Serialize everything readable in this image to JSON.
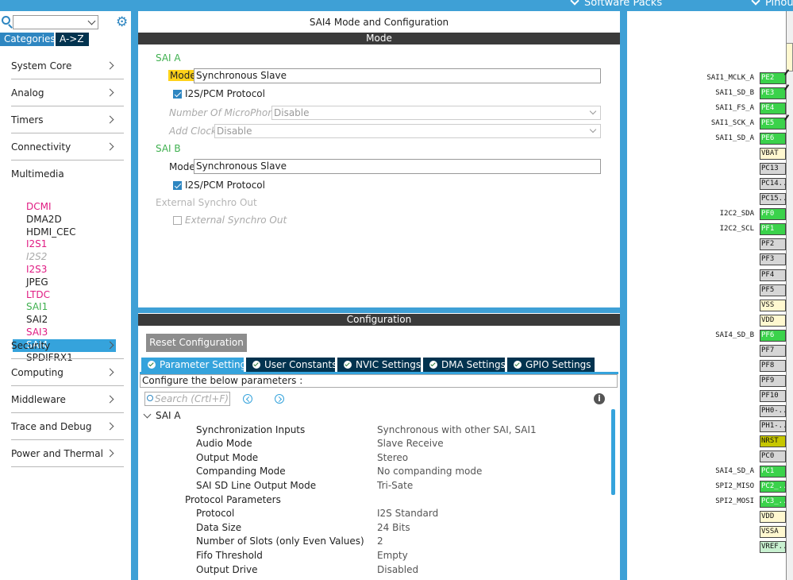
{
  "topbar": {
    "items": [
      {
        "label": "Software Packs"
      },
      {
        "label": "Pinout"
      }
    ]
  },
  "sidebar": {
    "search_value": "",
    "tabs": {
      "categories": "Categories",
      "az": "A->Z"
    },
    "categories": [
      {
        "label": "System Core"
      },
      {
        "label": "Analog"
      },
      {
        "label": "Timers"
      },
      {
        "label": "Connectivity"
      },
      {
        "label": "Multimedia"
      },
      {
        "label": "Security"
      },
      {
        "label": "Computing"
      },
      {
        "label": "Middleware"
      },
      {
        "label": "Trace and Debug"
      },
      {
        "label": "Power and Thermal"
      }
    ],
    "multimedia_items": [
      {
        "label": "DCMI",
        "status": "magenta"
      },
      {
        "label": "DMA2D",
        "status": "dark"
      },
      {
        "label": "HDMI_CEC",
        "status": "dark"
      },
      {
        "label": "I2S1",
        "status": "magenta"
      },
      {
        "label": "I2S2",
        "status": "grey"
      },
      {
        "label": "I2S3",
        "status": "magenta"
      },
      {
        "label": "JPEG",
        "status": "dark"
      },
      {
        "label": "LTDC",
        "status": "magenta"
      },
      {
        "label": "SAI1",
        "status": "green"
      },
      {
        "label": "SAI2",
        "status": "dark"
      },
      {
        "label": "SAI3",
        "status": "magenta"
      },
      {
        "label": "SAI4",
        "status": "selected"
      },
      {
        "label": "SPDIFRX1",
        "status": "dark"
      }
    ]
  },
  "mode_panel": {
    "title": "SAI4 Mode and Configuration",
    "bar": "Mode",
    "sai_a": {
      "title": "SAI A",
      "mode_label": "Mode",
      "mode_value": "Synchronous Slave",
      "protocol_label": "I2S/PCM Protocol",
      "microphones_label": "Number Of MicroPhones",
      "microphones_value": "Disable",
      "add_clock_label": "Add Clock",
      "add_clock_value": "Disable"
    },
    "sai_b": {
      "title": "SAI B",
      "mode_label": "Mode",
      "mode_value": "Synchronous Slave",
      "protocol_label": "I2S/PCM Protocol"
    },
    "ext_sync": {
      "title": "External Synchro Out",
      "checkbox_label": "External Synchro Out"
    }
  },
  "config_panel": {
    "bar": "Configuration",
    "reset_button": "Reset Configuration",
    "tabs": [
      {
        "label": "Parameter Settings",
        "active": true
      },
      {
        "label": "User Constants",
        "active": false
      },
      {
        "label": "NVIC Settings",
        "active": false
      },
      {
        "label": "DMA Settings",
        "active": false
      },
      {
        "label": "GPIO Settings",
        "active": false
      }
    ],
    "description": "Configure the below parameters :",
    "search_placeholder": "Search (Crtl+F)",
    "tree_group": "SAI A",
    "params": [
      {
        "name": "Synchronization Inputs",
        "value": "Synchronous with other SAI, SAI1",
        "level": 2
      },
      {
        "name": "Audio Mode",
        "value": "Slave Receive",
        "level": 2
      },
      {
        "name": "Output Mode",
        "value": "Stereo",
        "level": 2
      },
      {
        "name": "Companding Mode",
        "value": "No companding mode",
        "level": 2
      },
      {
        "name": "SAI SD Line Output Mode",
        "value": "Tri-Sate",
        "level": 2
      },
      {
        "name": "Protocol Parameters",
        "value": "",
        "level": 1
      },
      {
        "name": "Protocol",
        "value": "I2S Standard",
        "level": 2
      },
      {
        "name": "Data Size",
        "value": "24 Bits",
        "level": 2
      },
      {
        "name": "Number of Slots (only Even Values)",
        "value": "2",
        "level": 2
      },
      {
        "name": "Fifo Threshold",
        "value": "Empty",
        "level": 2
      },
      {
        "name": "Output Drive",
        "value": "Disabled",
        "level": 2
      }
    ]
  },
  "pinout": {
    "pins": [
      {
        "pin": "PE2",
        "label": "SAI1_MCLK_A",
        "color": "green",
        "marked": true
      },
      {
        "pin": "PE3",
        "label": "SAI1_SD_B",
        "color": "green",
        "marked": true
      },
      {
        "pin": "PE4",
        "label": "SAI1_FS_A",
        "color": "green",
        "marked": false
      },
      {
        "pin": "PE5",
        "label": "SAI1_SCK_A",
        "color": "green",
        "marked": true
      },
      {
        "pin": "PE6",
        "label": "SAI1_SD_A",
        "color": "green",
        "marked": false
      },
      {
        "pin": "VBAT",
        "label": "",
        "color": "yellow",
        "marked": false
      },
      {
        "pin": "PC13",
        "label": "",
        "color": "grey",
        "marked": false
      },
      {
        "pin": "PC14..",
        "label": "",
        "color": "grey",
        "marked": false
      },
      {
        "pin": "PC15..",
        "label": "",
        "color": "grey",
        "marked": false
      },
      {
        "pin": "PF0",
        "label": "I2C2_SDA",
        "color": "green",
        "marked": false
      },
      {
        "pin": "PF1",
        "label": "I2C2_SCL",
        "color": "green",
        "marked": false
      },
      {
        "pin": "PF2",
        "label": "",
        "color": "grey",
        "marked": false
      },
      {
        "pin": "PF3",
        "label": "",
        "color": "grey",
        "marked": false
      },
      {
        "pin": "PF4",
        "label": "",
        "color": "grey",
        "marked": false
      },
      {
        "pin": "PF5",
        "label": "",
        "color": "grey",
        "marked": false
      },
      {
        "pin": "VSS",
        "label": "",
        "color": "yellow",
        "marked": false
      },
      {
        "pin": "VDD",
        "label": "",
        "color": "yellow",
        "marked": false
      },
      {
        "pin": "PF6",
        "label": "SAI4_SD_B",
        "color": "green",
        "marked": false
      },
      {
        "pin": "PF7",
        "label": "",
        "color": "grey",
        "marked": false
      },
      {
        "pin": "PF8",
        "label": "",
        "color": "grey",
        "marked": false
      },
      {
        "pin": "PF9",
        "label": "",
        "color": "grey",
        "marked": false
      },
      {
        "pin": "PF10",
        "label": "",
        "color": "grey",
        "marked": false
      },
      {
        "pin": "PH0-..",
        "label": "",
        "color": "grey",
        "marked": false
      },
      {
        "pin": "PH1-..",
        "label": "",
        "color": "grey",
        "marked": false
      },
      {
        "pin": "NRST",
        "label": "",
        "color": "olive",
        "marked": false
      },
      {
        "pin": "PC0",
        "label": "",
        "color": "grey",
        "marked": false
      },
      {
        "pin": "PC1",
        "label": "SAI4_SD_A",
        "color": "green",
        "marked": false
      },
      {
        "pin": "PC2_..",
        "label": "SPI2_MISO",
        "color": "green",
        "marked": false
      },
      {
        "pin": "PC3_..",
        "label": "SPI2_MOSI",
        "color": "green",
        "marked": false
      },
      {
        "pin": "VDD",
        "label": "",
        "color": "yellow",
        "marked": false
      },
      {
        "pin": "VSSA",
        "label": "",
        "color": "yellow",
        "marked": false
      },
      {
        "pin": "VREF..",
        "label": "",
        "color": "mint",
        "marked": false
      }
    ]
  }
}
